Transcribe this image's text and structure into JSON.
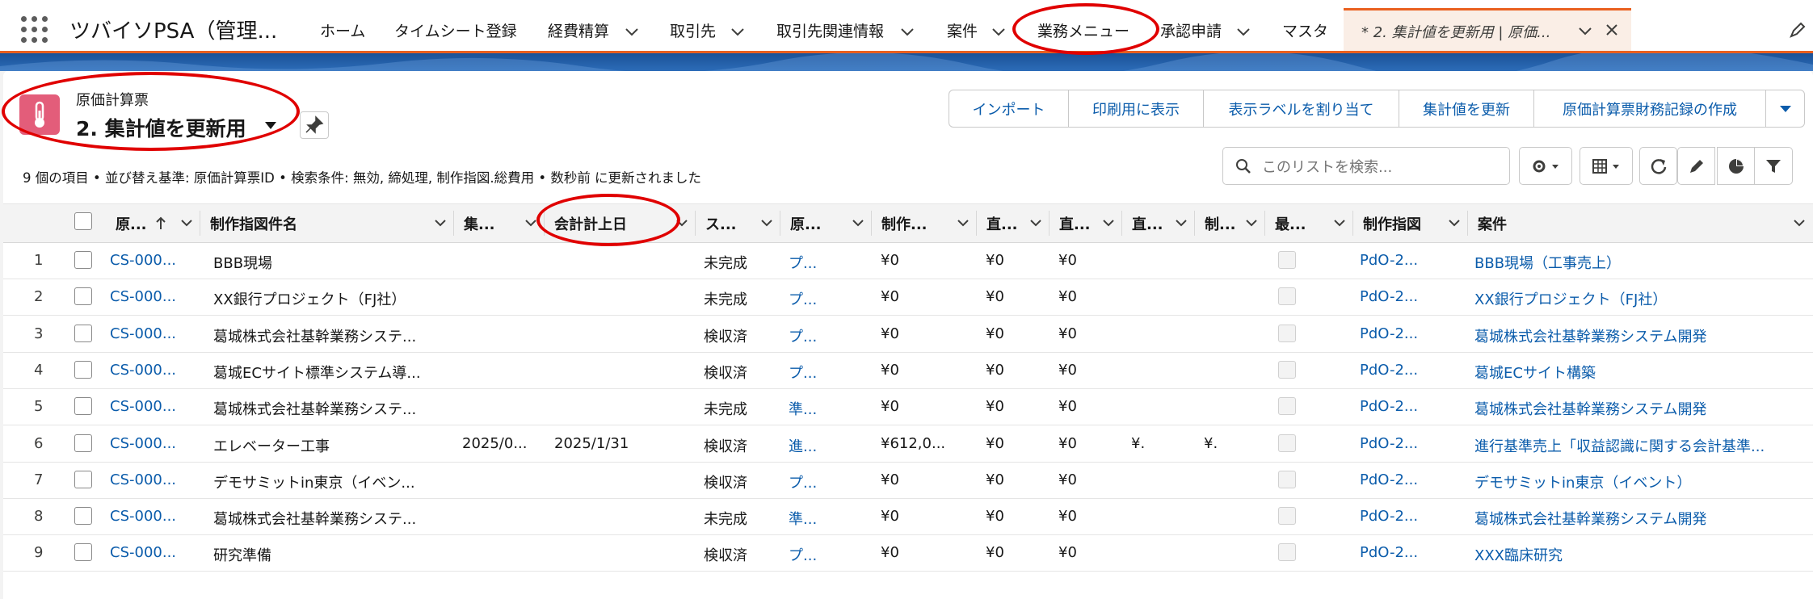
{
  "app": {
    "name": "ツバイソPSA（管理..."
  },
  "nav": {
    "items": [
      {
        "label": "ホーム",
        "chevron": false
      },
      {
        "label": "タイムシート登録",
        "chevron": false
      },
      {
        "label": "経費精算",
        "chevron": true
      },
      {
        "label": "取引先",
        "chevron": true
      },
      {
        "label": "取引先関連情報",
        "chevron": true
      },
      {
        "label": "案件",
        "chevron": true
      },
      {
        "label": "業務メニュー",
        "chevron": false
      },
      {
        "label": "承認申請",
        "chevron": true
      },
      {
        "label": "マスタ",
        "chevron": false
      }
    ],
    "active_tab": "* 2. 集計値を更新用 | 原価..."
  },
  "header": {
    "object_label": "原価計算票",
    "list_view_name": "2. 集計値を更新用",
    "info_line": "9 個の項目 • 並び替え基準: 原価計算票ID • 検索条件: 無効, 締処理, 制作指図.総費用 • 数秒前 に更新されました"
  },
  "actions": [
    "インポート",
    "印刷用に表示",
    "表示ラベルを割り当て",
    "集計値を更新",
    "原価計算票財務記録の作成"
  ],
  "search": {
    "placeholder": "このリストを検索..."
  },
  "columns": [
    "原...",
    "制作指図件名",
    "集...",
    "会計計上日",
    "ス...",
    "原...",
    "制作...",
    "直...",
    "直...",
    "直...",
    "制...",
    "最...",
    "制作指図",
    "案件"
  ],
  "rows": [
    {
      "n": "1",
      "id": "CS-000...",
      "name": "BBB現場",
      "agg": "",
      "date": "",
      "status": "未完成",
      "type": "プ...",
      "cost": "¥0",
      "d1": "¥0",
      "d2": "¥0",
      "d3": "",
      "s": "",
      "order": "PdO-2...",
      "project": "BBB現場（工事売上）"
    },
    {
      "n": "2",
      "id": "CS-000...",
      "name": "XX銀行プロジェクト（FJ社）",
      "agg": "",
      "date": "",
      "status": "未完成",
      "type": "プ...",
      "cost": "¥0",
      "d1": "¥0",
      "d2": "¥0",
      "d3": "",
      "s": "",
      "order": "PdO-2...",
      "project": "XX銀行プロジェクト（FJ社）"
    },
    {
      "n": "3",
      "id": "CS-000...",
      "name": "葛城株式会社基幹業務システ...",
      "agg": "",
      "date": "",
      "status": "検収済",
      "type": "プ...",
      "cost": "¥0",
      "d1": "¥0",
      "d2": "¥0",
      "d3": "",
      "s": "",
      "order": "PdO-2...",
      "project": "葛城株式会社基幹業務システム開発"
    },
    {
      "n": "4",
      "id": "CS-000...",
      "name": "葛城ECサイト標準システム導...",
      "agg": "",
      "date": "",
      "status": "検収済",
      "type": "プ...",
      "cost": "¥0",
      "d1": "¥0",
      "d2": "¥0",
      "d3": "",
      "s": "",
      "order": "PdO-2...",
      "project": "葛城ECサイト構築"
    },
    {
      "n": "5",
      "id": "CS-000...",
      "name": "葛城株式会社基幹業務システ...",
      "agg": "",
      "date": "",
      "status": "未完成",
      "type": "準...",
      "cost": "¥0",
      "d1": "¥0",
      "d2": "¥0",
      "d3": "",
      "s": "",
      "order": "PdO-2...",
      "project": "葛城株式会社基幹業務システム開発"
    },
    {
      "n": "6",
      "id": "CS-000...",
      "name": "エレベーター工事",
      "agg": "2025/0...",
      "date": "2025/1/31",
      "status": "検収済",
      "type": "進...",
      "cost": "¥612,0...",
      "d1": "¥0",
      "d2": "¥0",
      "d3": "¥.",
      "s": "¥.",
      "order": "PdO-2...",
      "project": "進行基準売上「収益認識に関する会計基準..."
    },
    {
      "n": "7",
      "id": "CS-000...",
      "name": "デモサミットin東京（イベン...",
      "agg": "",
      "date": "",
      "status": "検収済",
      "type": "プ...",
      "cost": "¥0",
      "d1": "¥0",
      "d2": "¥0",
      "d3": "",
      "s": "",
      "order": "PdO-2...",
      "project": "デモサミットin東京（イベント）"
    },
    {
      "n": "8",
      "id": "CS-000...",
      "name": "葛城株式会社基幹業務システ...",
      "agg": "",
      "date": "",
      "status": "未完成",
      "type": "準...",
      "cost": "¥0",
      "d1": "¥0",
      "d2": "¥0",
      "d3": "",
      "s": "",
      "order": "PdO-2...",
      "project": "葛城株式会社基幹業務システム開発"
    },
    {
      "n": "9",
      "id": "CS-000...",
      "name": "研究準備",
      "agg": "",
      "date": "",
      "status": "検収済",
      "type": "プ...",
      "cost": "¥0",
      "d1": "¥0",
      "d2": "¥0",
      "d3": "",
      "s": "",
      "order": "PdO-2...",
      "project": "XXX臨床研究"
    }
  ],
  "colors": {
    "accent": "#e9601f",
    "link": "#0b5cab",
    "object_icon": "#e35d7a",
    "annotation": "#e00000"
  }
}
